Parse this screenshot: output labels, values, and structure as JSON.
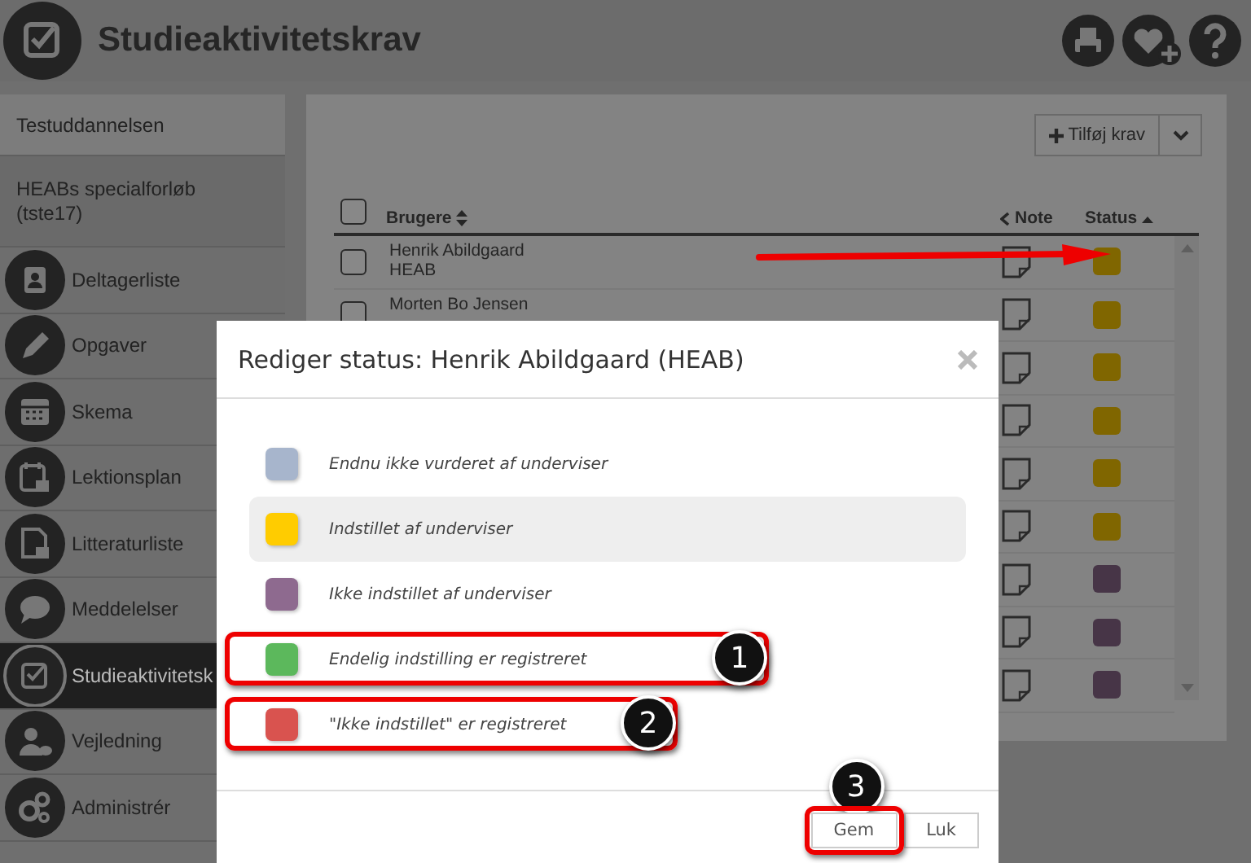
{
  "header": {
    "title": "Studieaktivitetskrav"
  },
  "sidebar": {
    "items": [
      {
        "label": "Testuddannelsen",
        "kind": "plain",
        "selected": false
      },
      {
        "label": "HEABs specialforløb (tste17)",
        "kind": "course",
        "selected": false
      },
      {
        "label": "Deltagerliste",
        "kind": "nav",
        "selected": false
      },
      {
        "label": "Opgaver",
        "kind": "nav",
        "selected": false
      },
      {
        "label": "Skema",
        "kind": "nav",
        "selected": false
      },
      {
        "label": "Lektionsplan",
        "kind": "nav",
        "selected": false
      },
      {
        "label": "Litteraturliste",
        "kind": "nav",
        "selected": false
      },
      {
        "label": "Meddelelser",
        "kind": "nav",
        "selected": false
      },
      {
        "label": "Studieaktivitetsk",
        "kind": "nav",
        "selected": true
      },
      {
        "label": "Vejledning",
        "kind": "nav",
        "selected": false
      },
      {
        "label": "Administrér",
        "kind": "nav",
        "selected": false
      }
    ]
  },
  "table": {
    "add_button": "Tilføj krav",
    "select_all_checked": false,
    "pointer_arrow": true,
    "columns": [
      "Brugere",
      "Note",
      "Status"
    ],
    "rows": [
      {
        "name": "Henrik Abildgaard",
        "code": "HEAB",
        "checked": false,
        "color": "#806600"
      },
      {
        "name": "Morten Bo Jensen",
        "checked": false,
        "color": "#806600"
      },
      {
        "color": "#806600"
      },
      {
        "color": "#806600"
      },
      {
        "color": "#806600"
      },
      {
        "color": "#806600"
      },
      {
        "color": "#473547"
      },
      {
        "color": "#473547"
      },
      {
        "color": "#473547"
      }
    ]
  },
  "dialog": {
    "title": "Rediger status: Henrik Abildgaard (HEAB)",
    "options": [
      {
        "label": "Endnu ikke vurderet af underviser",
        "color": "#a7b5cc",
        "selected": false,
        "highlighted": false
      },
      {
        "label": "Indstillet af underviser",
        "color": "#ffcc00",
        "selected": true,
        "highlighted": false
      },
      {
        "label": "Ikke indstillet af underviser",
        "color": "#8e6a8f",
        "selected": false,
        "highlighted": false
      },
      {
        "label": "Endelig indstilling er registreret",
        "color": "#5cb85c",
        "selected": false,
        "highlighted": true,
        "callout": "1"
      },
      {
        "label": "\"Ikke indstillet\" er registreret",
        "color": "#d9534f",
        "selected": false,
        "highlighted": true,
        "callout": "2"
      }
    ],
    "buttons": [
      {
        "label": "Gem",
        "highlighted": true,
        "callout": "3"
      },
      {
        "label": "Luk",
        "highlighted": false
      }
    ]
  }
}
